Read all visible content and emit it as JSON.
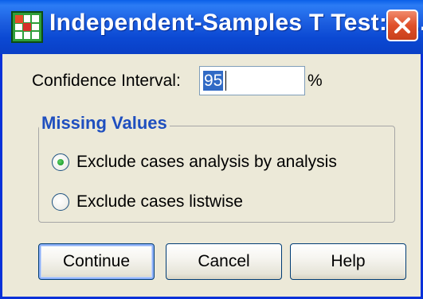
{
  "window": {
    "title": "Independent-Samples T Test: O...",
    "title_icon": "spss-grid-icon",
    "close_icon": "close-icon"
  },
  "confidence_interval": {
    "label": "Confidence Interval:",
    "value": "95",
    "unit": "%"
  },
  "missing_values": {
    "title": "Missing Values",
    "options": [
      {
        "label": "Exclude cases analysis by analysis",
        "selected": true
      },
      {
        "label": "Exclude cases listwise",
        "selected": false
      }
    ]
  },
  "buttons": {
    "continue": "Continue",
    "cancel": "Cancel",
    "help": "Help"
  },
  "colors": {
    "titlebar": "#0b49d3",
    "group_title": "#1f4fbf",
    "dialog_bg": "#ece9d8",
    "close_button": "#e0502a"
  }
}
